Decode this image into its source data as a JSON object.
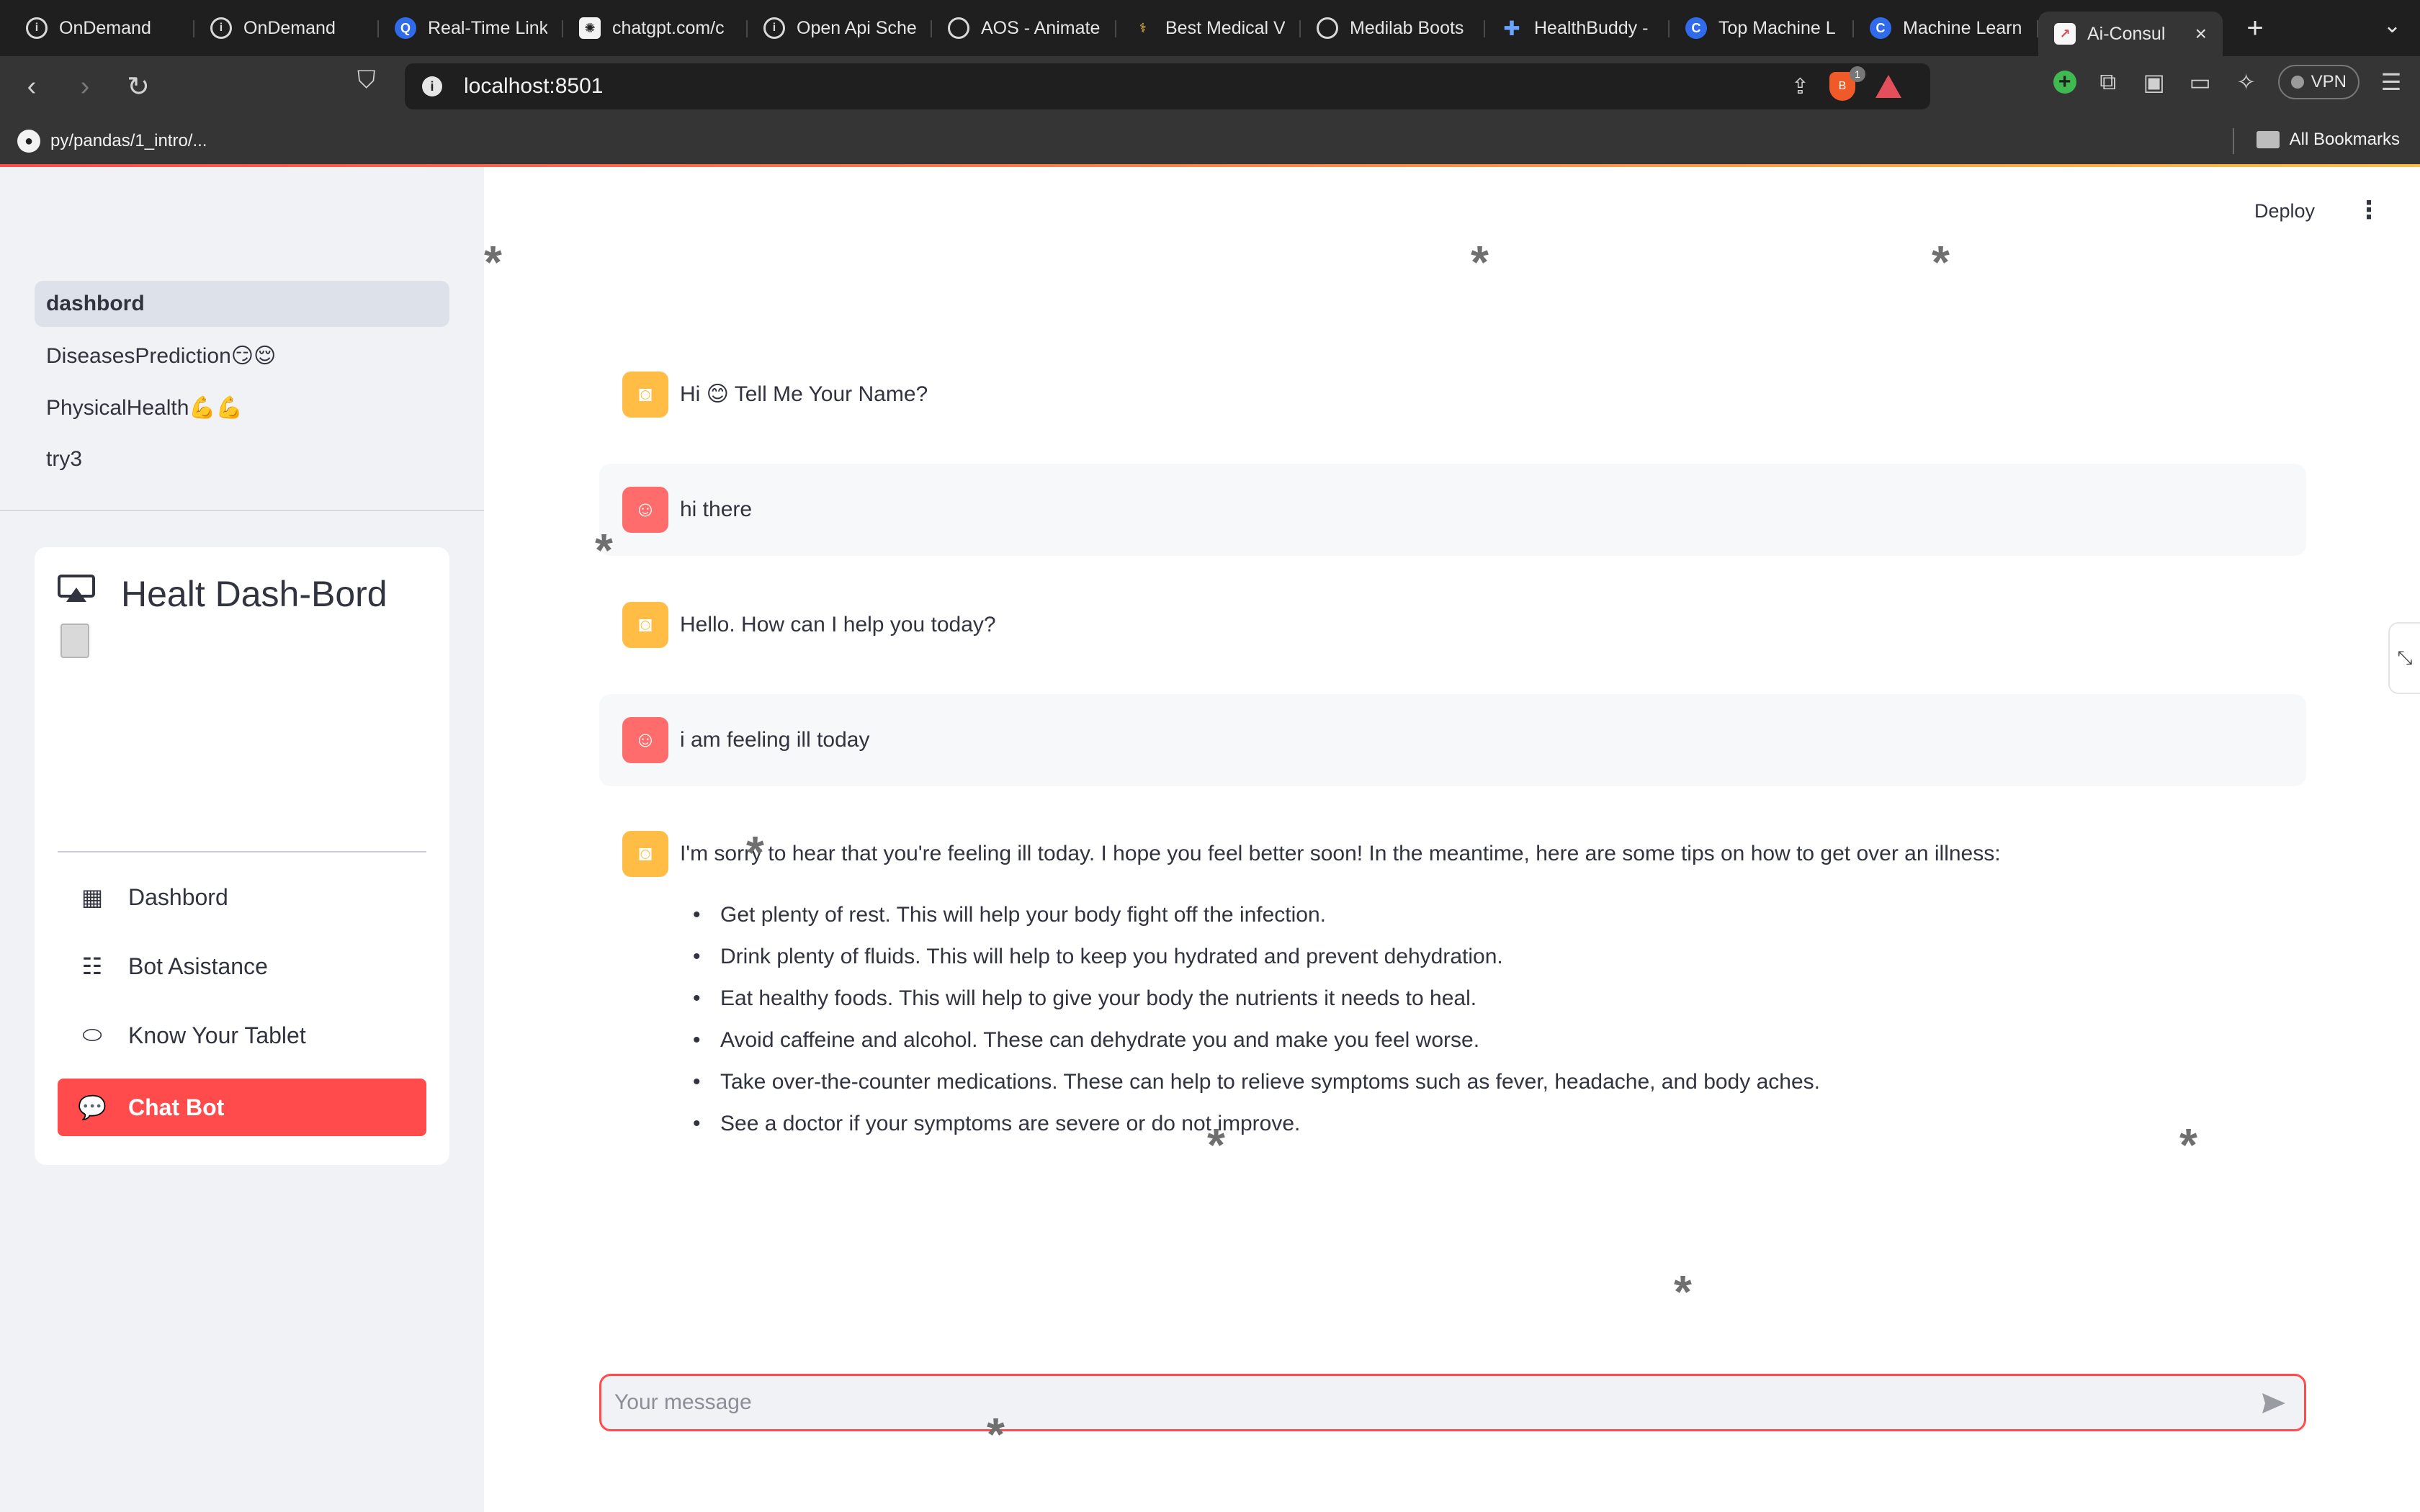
{
  "browser": {
    "tabs": [
      {
        "title": "OnDemand",
        "icon": "info-icon"
      },
      {
        "title": "OnDemand",
        "icon": "info-icon"
      },
      {
        "title": "Real-Time Link",
        "icon": "realtime-icon"
      },
      {
        "title": "chatgpt.com/c",
        "icon": "chatgpt-icon"
      },
      {
        "title": "Open Api Sche",
        "icon": "info-icon"
      },
      {
        "title": "AOS - Animate",
        "icon": "globe-icon"
      },
      {
        "title": "Best Medical V",
        "icon": "medical-icon"
      },
      {
        "title": "Medilab Boots",
        "icon": "globe-icon"
      },
      {
        "title": "HealthBuddy -",
        "icon": "health-cross-icon"
      },
      {
        "title": "Top Machine L",
        "icon": "c-logo-icon"
      },
      {
        "title": "Machine Learn",
        "icon": "c-logo-icon"
      },
      {
        "title": "Ai-Consul",
        "icon": "chart-icon"
      }
    ],
    "url": "localhost:8501",
    "brave_badge": "1",
    "vpn_label": "VPN",
    "bookmark": "py/pandas/1_intro/...",
    "all_bookmarks": "All Bookmarks"
  },
  "sidebar": {
    "pages": [
      "dashbord",
      "DiseasesPrediction😏😌",
      "PhysicalHealth💪💪",
      "try3"
    ],
    "menu": {
      "title": "Healt Dash-Bord",
      "items": [
        {
          "label": "Dashbord",
          "icon": "grid-icon"
        },
        {
          "label": "Bot Asistance",
          "icon": "person-lines-icon"
        },
        {
          "label": "Know Your Tablet",
          "icon": "capsule-icon"
        },
        {
          "label": "Chat Bot",
          "icon": "chat-dots-icon"
        }
      ]
    }
  },
  "header": {
    "deploy_label": "Deploy"
  },
  "chat": {
    "messages": [
      {
        "role": "assistant",
        "text": "Hi 😊 Tell Me Your Name?"
      },
      {
        "role": "user",
        "text": "hi there"
      },
      {
        "role": "assistant",
        "text": "Hello. How can I help you today?"
      },
      {
        "role": "user",
        "text": "i am feeling ill today"
      },
      {
        "role": "assistant",
        "text": "I'm sorry to hear that you're feeling ill today. I hope you feel better soon! In the meantime, here are some tips on how to get over an illness:",
        "tips": [
          "Get plenty of rest. This will help your body fight off the infection.",
          "Drink plenty of fluids. This will help to keep you hydrated and prevent dehydration.",
          "Eat healthy foods. This will help to give your body the nutrients it needs to heal.",
          "Avoid caffeine and alcohol. These can dehydrate you and make you feel worse.",
          "Take over-the-counter medications. These can help to relieve symptoms such as fever, headache, and body aches.",
          "See a doctor if your symptoms are severe or do not improve."
        ]
      }
    ],
    "input_placeholder": "Your message",
    "input_value": ""
  },
  "colors": {
    "accent": "#ff4b4b",
    "bot_avatar": "#ffbd45",
    "user_avatar": "#ff6c6c",
    "sidebar_bg": "#f0f2f6"
  }
}
